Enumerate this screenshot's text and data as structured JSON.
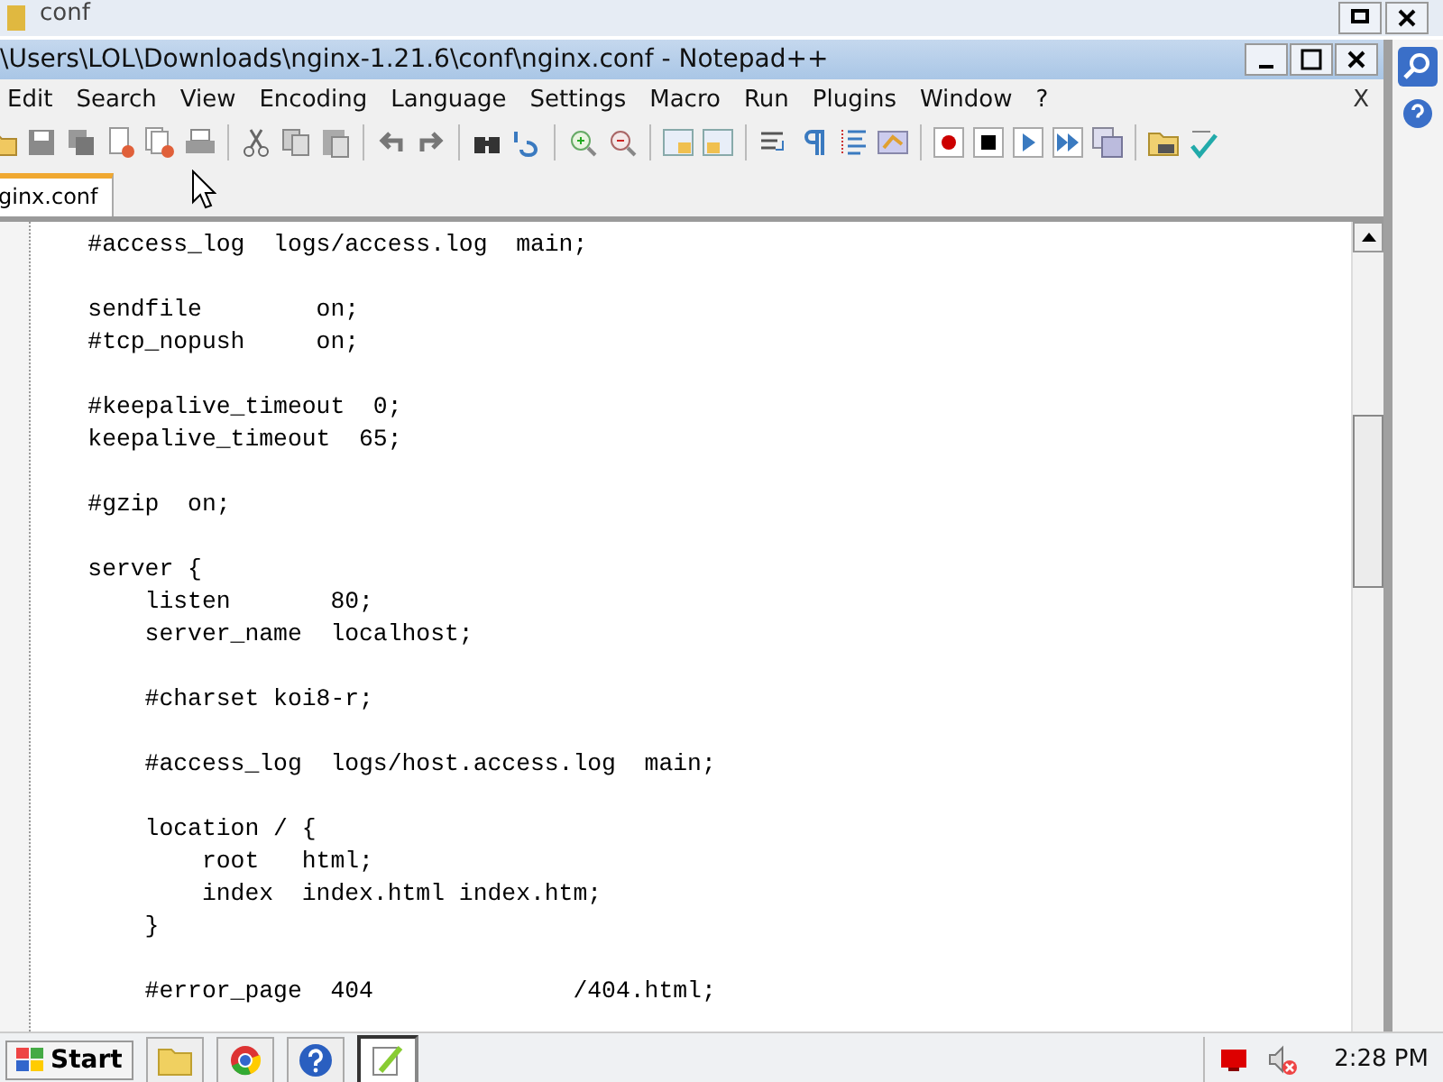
{
  "background_window": {
    "title": "conf"
  },
  "window": {
    "title": "\\Users\\LOL\\Downloads\\nginx-1.21.6\\conf\\nginx.conf - Notepad++",
    "menu": [
      "Edit",
      "Search",
      "View",
      "Encoding",
      "Language",
      "Settings",
      "Macro",
      "Run",
      "Plugins",
      "Window",
      "?"
    ],
    "close_document": "X"
  },
  "tabs": [
    {
      "label": "ginx.conf",
      "selected": true
    }
  ],
  "editor": {
    "lines": [
      {
        "kind": "code",
        "text": "    #access_log  logs/access.log  main;"
      },
      {
        "kind": "blank"
      },
      {
        "kind": "code",
        "text": "    sendfile        on;"
      },
      {
        "kind": "code",
        "text": "    #tcp_nopush     on;"
      },
      {
        "kind": "blank"
      },
      {
        "kind": "code",
        "text": "    #keepalive_timeout  0;"
      },
      {
        "kind": "code",
        "text": "    keepalive_timeout  65;"
      },
      {
        "kind": "blank"
      },
      {
        "kind": "code",
        "text": "    #gzip  on;"
      },
      {
        "kind": "blank"
      },
      {
        "kind": "code",
        "text": "    server {"
      },
      {
        "kind": "code",
        "text": "        listen       80;"
      },
      {
        "kind": "code",
        "text": "        server_name  localhost;"
      },
      {
        "kind": "blank"
      },
      {
        "kind": "code",
        "text": "        #charset koi8-r;"
      },
      {
        "kind": "blank"
      },
      {
        "kind": "code",
        "text": "        #access_log  logs/host.access.log  main;"
      },
      {
        "kind": "blank"
      },
      {
        "kind": "code",
        "text": "        location / {"
      },
      {
        "kind": "code",
        "text": "            root   html;"
      },
      {
        "kind": "code",
        "text": "            index  index.html index.htm;"
      },
      {
        "kind": "code",
        "text": "        }"
      },
      {
        "kind": "blank"
      },
      {
        "kind": "code",
        "text": "        #error_page  404              /404.html;"
      }
    ]
  },
  "taskbar": {
    "start": "Start",
    "buttons": [
      {
        "kind": "folder",
        "selected": false
      },
      {
        "kind": "browser",
        "selected": false
      },
      {
        "kind": "help",
        "selected": false
      },
      {
        "kind": "notepad",
        "selected": true
      }
    ],
    "clock": "2:28 PM"
  }
}
